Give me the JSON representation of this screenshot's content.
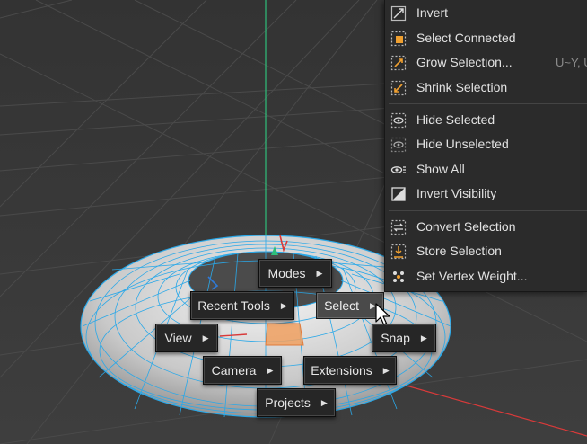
{
  "pie_menu": {
    "modes": "Modes",
    "recent_tools": "Recent Tools",
    "select": "Select",
    "view": "View",
    "snap": "Snap",
    "camera": "Camera",
    "extensions": "Extensions",
    "projects": "Projects"
  },
  "select_menu": {
    "items": [
      {
        "label": "Invert",
        "icon": "invert-selection-icon"
      },
      {
        "label": "Select Connected",
        "icon": "select-connected-icon"
      },
      {
        "label": "Grow Selection...",
        "icon": "grow-selection-icon",
        "shortcut": "U~Y, U"
      },
      {
        "label": "Shrink Selection",
        "icon": "shrink-selection-icon"
      },
      {
        "label": "Hide Selected",
        "icon": "hide-selected-icon"
      },
      {
        "label": "Hide Unselected",
        "icon": "hide-unselected-icon"
      },
      {
        "label": "Show All",
        "icon": "show-all-icon"
      },
      {
        "label": "Invert Visibility",
        "icon": "invert-visibility-icon"
      },
      {
        "label": "Convert Selection",
        "icon": "convert-selection-icon"
      },
      {
        "label": "Store Selection",
        "icon": "store-selection-icon"
      },
      {
        "label": "Set Vertex Weight...",
        "icon": "set-vertex-weight-icon"
      }
    ]
  },
  "colors": {
    "viewport_bg": "#3a3a3a",
    "wireframe": "#2aa8e8",
    "y_axis": "#2fbf7a",
    "x_axis": "#d83a3a",
    "selected_polygon": "#f0a060"
  }
}
